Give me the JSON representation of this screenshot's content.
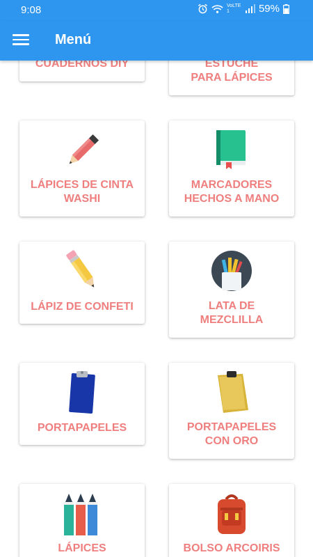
{
  "status": {
    "time": "9:08",
    "network": "VoLTE1",
    "battery": "59%"
  },
  "appbar": {
    "title": "Menú",
    "menu_icon": "hamburger-menu-icon"
  },
  "cards": [
    {
      "label": "CUADERNOS DIY",
      "icon": "notebook-icon"
    },
    {
      "label": "ESTUCHE PARA LÁPICES",
      "icon": "pencil-case-icon"
    },
    {
      "label": "LÁPICES DE CINTA WASHI",
      "icon": "pencil-icon"
    },
    {
      "label": "MARCADORES HECHOS A MANO",
      "icon": "green-book-icon"
    },
    {
      "label": "LÁPIZ DE CONFETI",
      "icon": "yellow-pencil-icon"
    },
    {
      "label": "LATA DE MEZCLILLA",
      "icon": "pencil-cup-icon"
    },
    {
      "label": "PORTAPAPELES",
      "icon": "blue-clipboard-icon"
    },
    {
      "label": "PORTAPAPELES CON ORO",
      "icon": "gold-clipboard-icon"
    },
    {
      "label": "LÁPICES",
      "icon": "colored-pencils-icon"
    },
    {
      "label": "BOLSO ARCOIRIS",
      "icon": "backpack-icon"
    }
  ]
}
